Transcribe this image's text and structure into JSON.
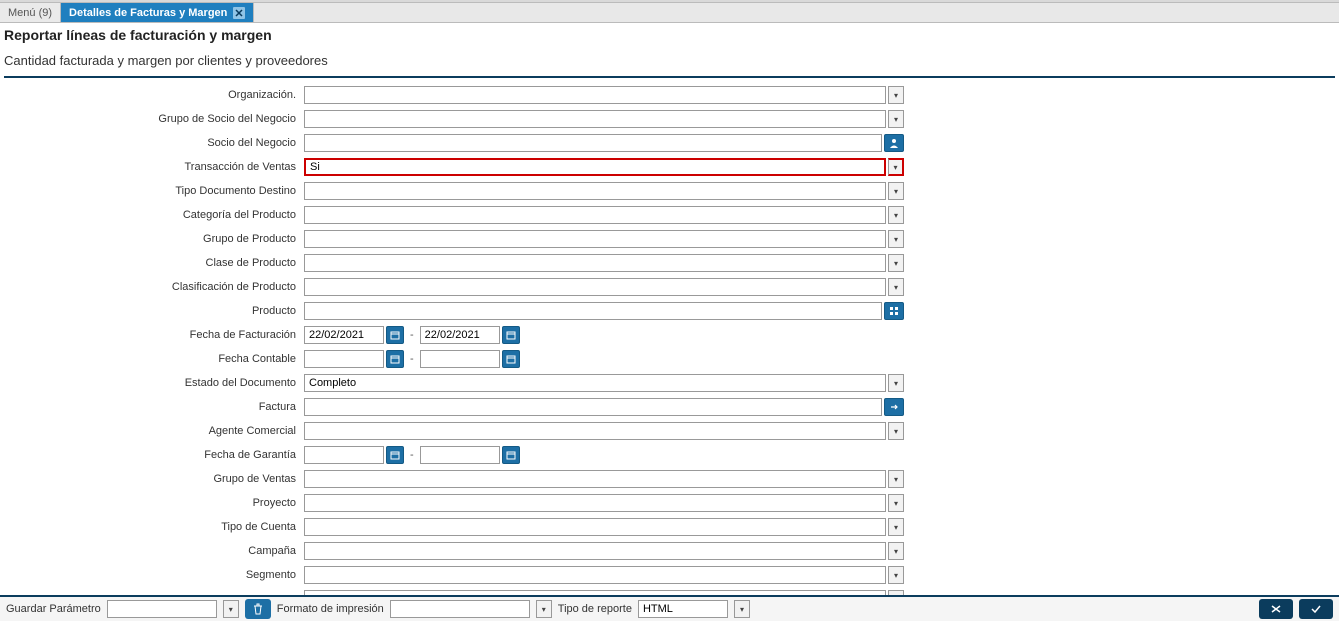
{
  "tabs": {
    "menu": "Menú (9)",
    "active": "Detalles de Facturas y Margen"
  },
  "title": "Reportar líneas de facturación y margen",
  "subtitle": "Cantidad facturada y margen por clientes y proveedores",
  "labels": {
    "organizacion": "Organización.",
    "grupo_socio": "Grupo de Socio del Negocio",
    "socio": "Socio del Negocio",
    "trans_ventas": "Transacción de Ventas",
    "tipo_doc": "Tipo Documento Destino",
    "cat_producto": "Categoría del Producto",
    "grupo_producto": "Grupo de Producto",
    "clase_producto": "Clase de Producto",
    "clasif_producto": "Clasificación de Producto",
    "producto": "Producto",
    "fecha_fact": "Fecha de Facturación",
    "fecha_cont": "Fecha Contable",
    "estado_doc": "Estado del Documento",
    "factura": "Factura",
    "agente": "Agente Comercial",
    "fecha_garantia": "Fecha de Garantía",
    "grupo_ventas": "Grupo de Ventas",
    "proyecto": "Proyecto",
    "tipo_cuenta": "Tipo de Cuenta",
    "campana": "Campaña",
    "segmento": "Segmento"
  },
  "values": {
    "trans_ventas": "Si",
    "fecha_fact_from": "22/02/2021",
    "fecha_fact_to": "22/02/2021",
    "estado_doc": "Completo"
  },
  "footer": {
    "guardar": "Guardar Parámetro",
    "formato": "Formato de impresión",
    "tipo_reporte": "Tipo de reporte",
    "tipo_reporte_val": "HTML"
  },
  "sep": "-"
}
